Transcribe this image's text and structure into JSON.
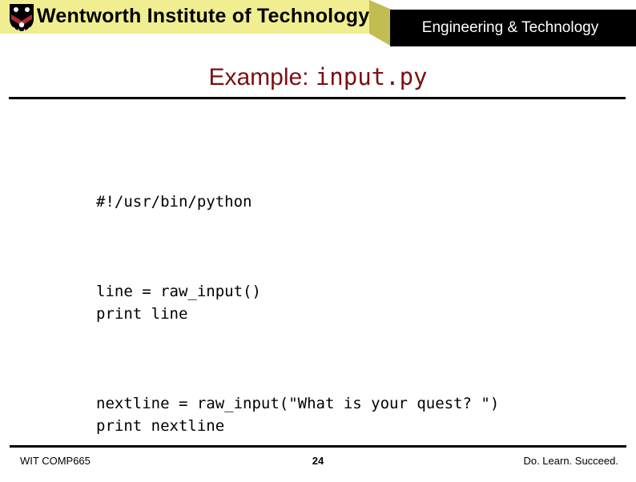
{
  "header": {
    "institution": "Wentworth Institute of Technology",
    "department": "Engineering & Technology",
    "logo_icon": "wentworth-shield-crest-icon",
    "banner_yellow": "#f0ee91",
    "banner_wedge": "#c2bd52",
    "banner_black": "#000000"
  },
  "title": {
    "prefix": "Example: ",
    "filename": "input.py",
    "color": "#7b0f11"
  },
  "code": {
    "blocks": [
      "#!/usr/bin/python",
      "line = raw_input()\nprint line",
      "nextline = raw_input(\"What is your quest? \")\nprint nextline"
    ]
  },
  "footer": {
    "course": "WIT COMP665",
    "page_number": "24",
    "tagline": "Do. Learn. Succeed."
  }
}
